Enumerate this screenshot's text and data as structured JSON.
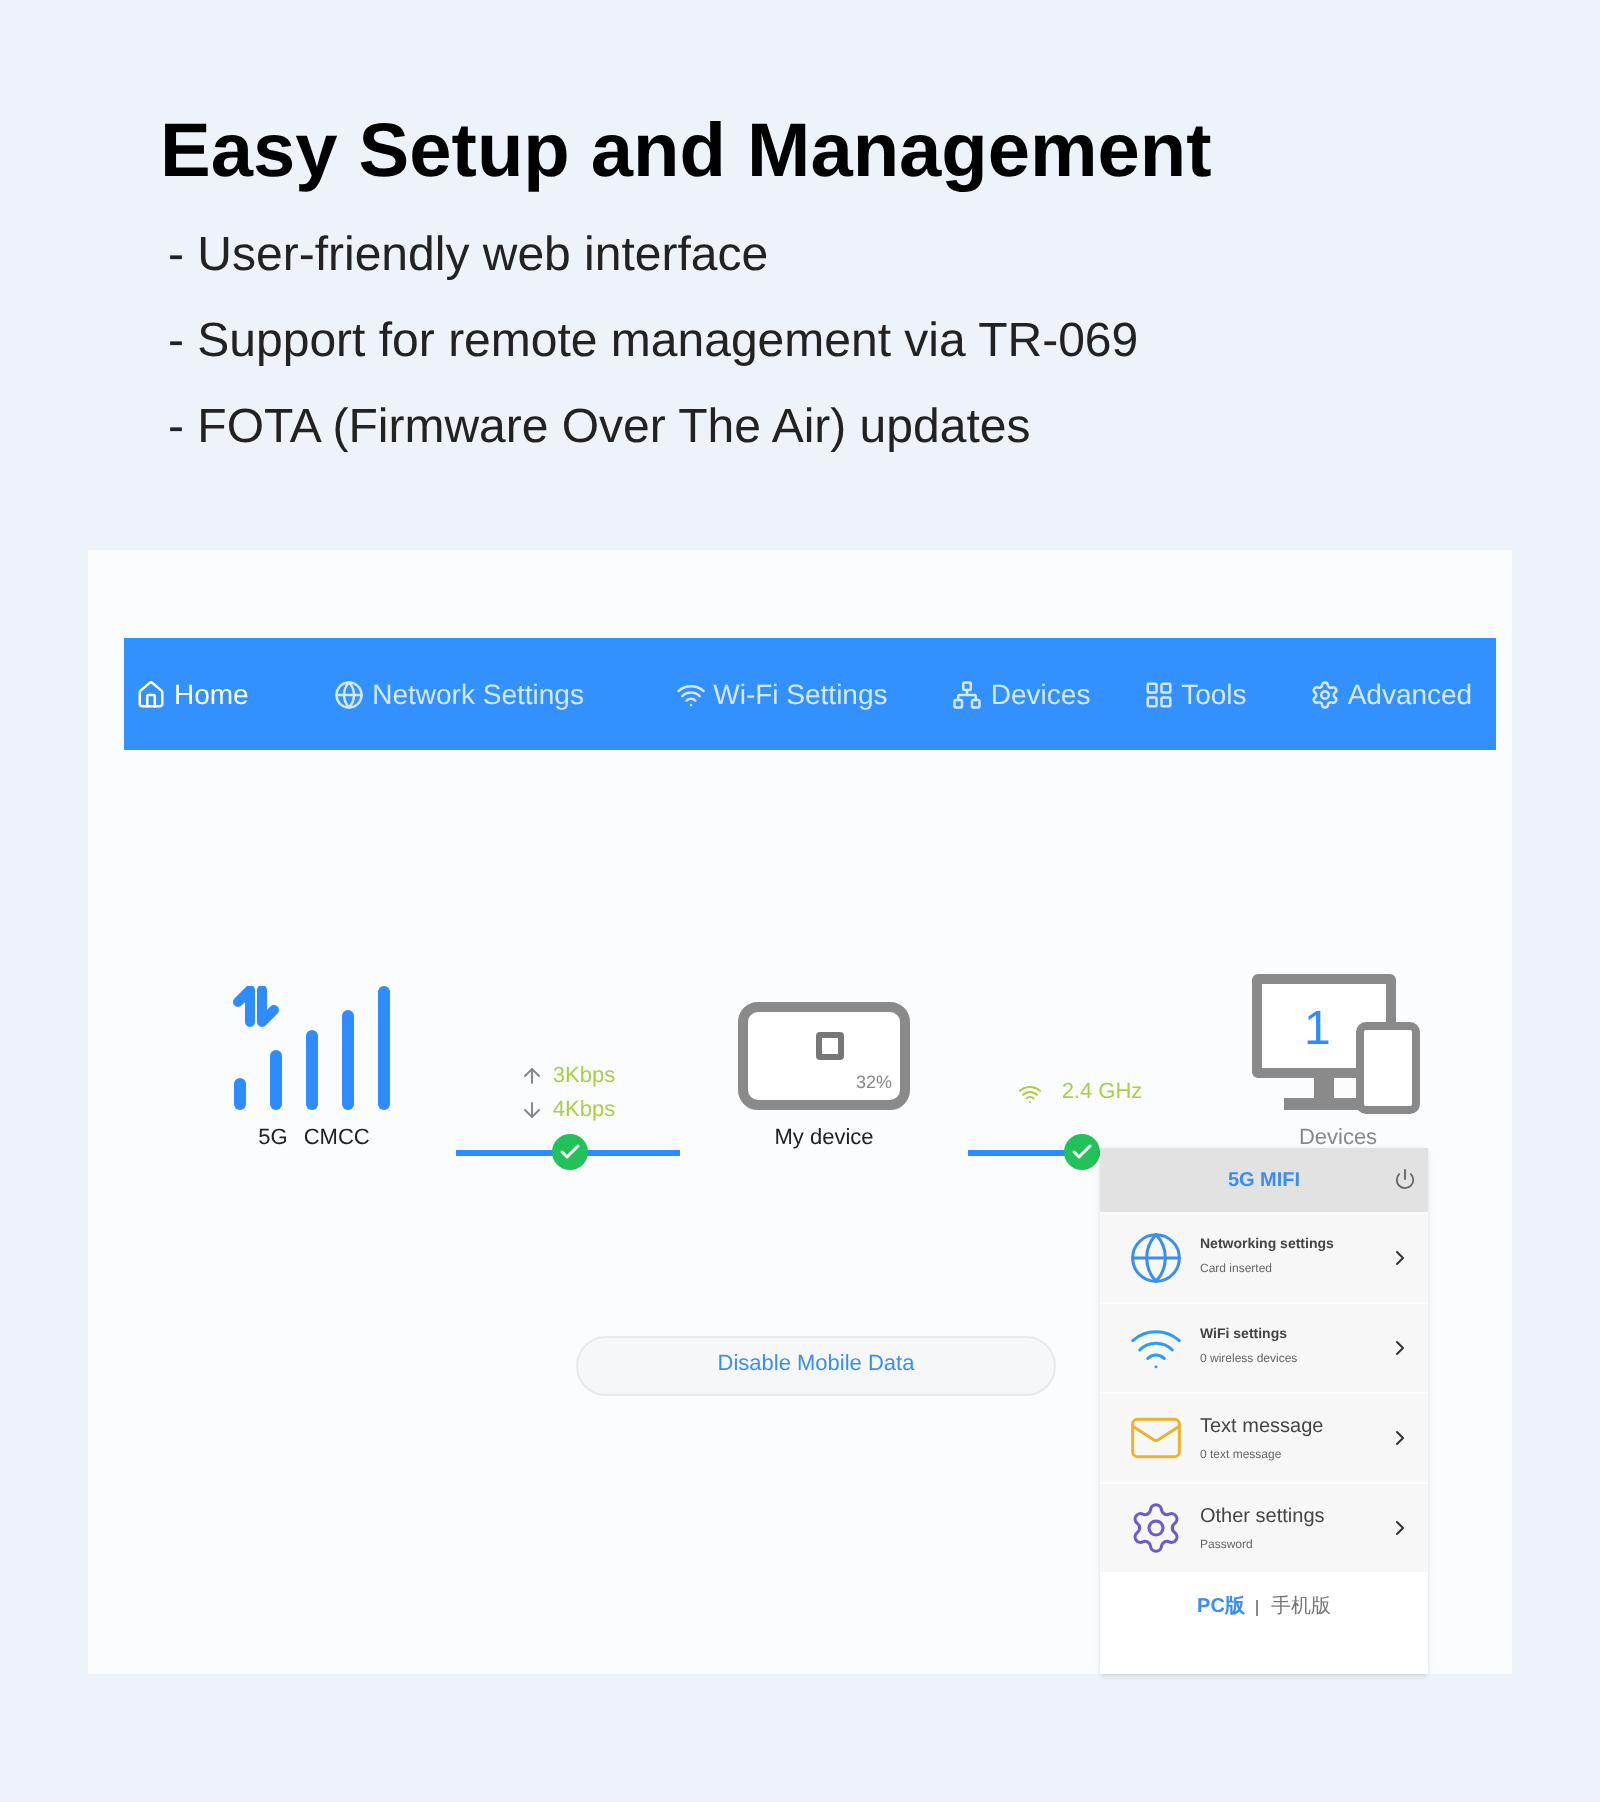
{
  "heading": "Easy Setup and Management",
  "bullets": [
    "- User-friendly web interface",
    "- Support for remote management via TR-069",
    "- FOTA (Firmware Over The Air) updates"
  ],
  "nav": {
    "tabs": [
      {
        "label": "Home",
        "kind": "home",
        "selected": true
      },
      {
        "label": "Network Settings",
        "kind": "globe",
        "selected": false
      },
      {
        "label": "Wi-Fi Settings",
        "kind": "wifi",
        "selected": false
      },
      {
        "label": "Devices",
        "kind": "network",
        "selected": false
      },
      {
        "label": "Tools",
        "kind": "grid",
        "selected": false
      },
      {
        "label": "Advanced",
        "kind": "gear",
        "selected": false
      }
    ]
  },
  "status": {
    "network": "5G",
    "operator": "CMCC",
    "upload": "3Kbps",
    "download": "4Kbps",
    "battery": "32%",
    "device_label": "My device",
    "band": "2.4 GHz",
    "device_count": "1",
    "devices_label": "Devices"
  },
  "button": "Disable Mobile Data",
  "mobile": {
    "title": "5G MIFI",
    "items": [
      {
        "title": "Networking settings",
        "subtitle": "Card inserted",
        "kind": "globe"
      },
      {
        "title": "WiFi settings",
        "subtitle": "0 wireless devices",
        "kind": "wifi"
      },
      {
        "title": "Text message",
        "subtitle": "0 text message",
        "kind": "mail"
      },
      {
        "title": "Other settings",
        "subtitle": "Password",
        "kind": "gear"
      }
    ],
    "footer": [
      {
        "label": "PC版",
        "selected": true
      },
      {
        "label": "手机版",
        "selected": false
      }
    ]
  }
}
